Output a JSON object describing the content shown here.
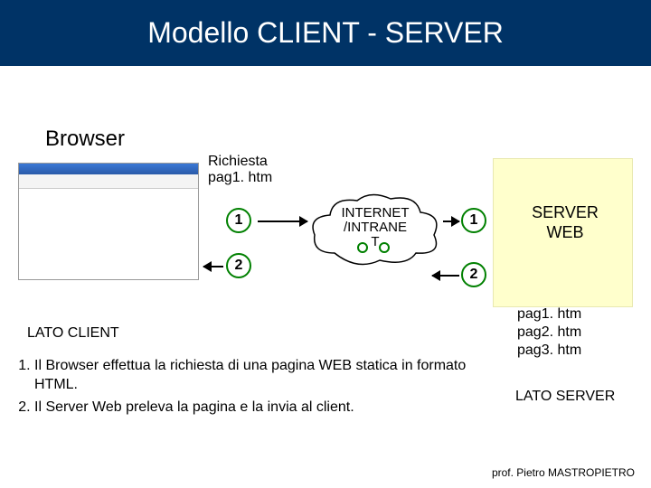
{
  "title": "Modello CLIENT - SERVER",
  "browser_label": "Browser",
  "request_label": "Richiesta\npag1. htm",
  "cloud_text": "INTERNET\n/INTRANE\nT",
  "server_label": "SERVER\nWEB",
  "marker1": "1",
  "marker2": "2",
  "marker1r": "1",
  "marker2r": "2",
  "files": {
    "f1": "pag1. htm",
    "f2": "pag2. htm",
    "f3": "pag3. htm"
  },
  "lato_client": "LATO CLIENT",
  "lato_server": "LATO SERVER",
  "steps": {
    "s1": "Il Browser effettua la richiesta di una pagina WEB statica in formato HTML.",
    "s2": "Il Server Web preleva la pagina e la invia al client."
  },
  "footer": "prof. Pietro MASTROPIETRO"
}
